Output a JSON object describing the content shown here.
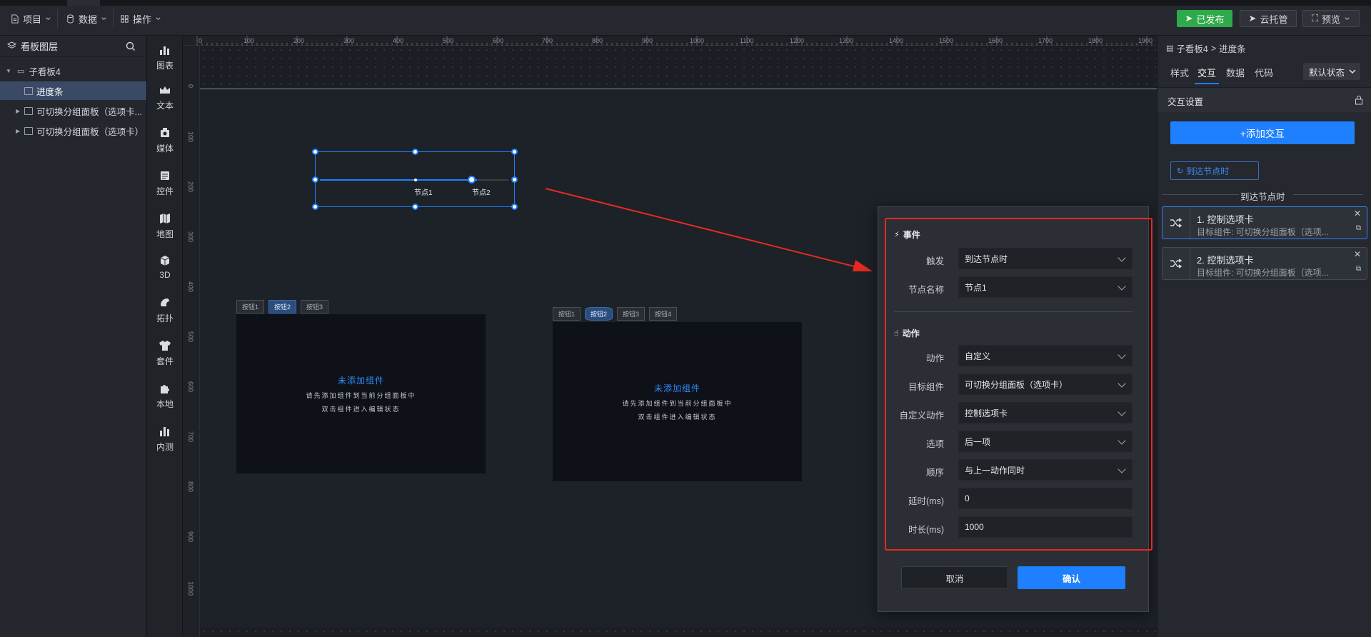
{
  "topbar": {
    "menus": [
      {
        "label": "项目",
        "icon": "file-icon"
      },
      {
        "label": "数据",
        "icon": "database-icon"
      },
      {
        "label": "操作",
        "icon": "grid-icon"
      }
    ],
    "publish_label": "已发布",
    "cloud_label": "云托管",
    "preview_label": "预览"
  },
  "layers": {
    "title": "看板图层",
    "items": [
      {
        "label": "子看板4"
      },
      {
        "label": "进度条"
      },
      {
        "label": "可切换分组面板（选项卡..."
      },
      {
        "label": "可切换分组面板（选项卡）"
      }
    ]
  },
  "iconbar": {
    "items": [
      {
        "label": "图表",
        "icon": "chart-icon"
      },
      {
        "label": "文本",
        "icon": "crown-icon"
      },
      {
        "label": "媒体",
        "icon": "media-icon"
      },
      {
        "label": "控件",
        "icon": "widget-icon"
      },
      {
        "label": "地图",
        "icon": "map-icon"
      },
      {
        "label": "3D",
        "icon": "cube-icon"
      },
      {
        "label": "拓扑",
        "icon": "topology-icon"
      },
      {
        "label": "套件",
        "icon": "shirt-icon"
      },
      {
        "label": "本地",
        "icon": "puzzle-icon"
      },
      {
        "label": "内测",
        "icon": "beta-chart-icon"
      }
    ]
  },
  "ruler": {
    "top": [
      "0",
      "100",
      "200",
      "300",
      "400",
      "500",
      "600",
      "700",
      "800",
      "900",
      "1000",
      "1100",
      "1200",
      "1300",
      "1400",
      "1500",
      "1600",
      "1700",
      "1800",
      "1900"
    ],
    "left": [
      "0",
      "100",
      "200",
      "300",
      "400",
      "500",
      "600",
      "700",
      "800",
      "900",
      "1000"
    ]
  },
  "canvas": {
    "progress": {
      "node1": "节点1",
      "node2": "节点2",
      "value": 0.75
    },
    "tabpanel1": {
      "tabs": [
        "按钮1",
        "按钮2",
        "按钮3"
      ],
      "active": 1,
      "empty_title": "未添加组件",
      "hint1": "请先添加组件到当前分组面板中",
      "hint2": "双击组件进入编辑状态"
    },
    "tabpanel2": {
      "tabs": [
        "按钮1",
        "按钮2",
        "按钮3",
        "按钮4"
      ],
      "active": 1,
      "empty_title": "未添加组件",
      "hint1": "请先添加组件到当前分组面板中",
      "hint2": "双击组件进入编辑状态"
    }
  },
  "dialog": {
    "event_title": "事件",
    "trigger_label": "触发",
    "trigger_value": "到达节点时",
    "node_label": "节点名称",
    "node_value": "节点1",
    "action_title": "动作",
    "action_label": "动作",
    "action_value": "自定义",
    "target_label": "目标组件",
    "target_value": "可切换分组面板（选项卡）",
    "custom_label": "自定义动作",
    "custom_value": "控制选项卡",
    "option_label": "选项",
    "option_value": "后一项",
    "order_label": "顺序",
    "order_value": "与上一动作同时",
    "delay_label": "延时(ms)",
    "delay_value": "0",
    "duration_label": "时长(ms)",
    "duration_value": "1000",
    "cancel_label": "取消",
    "confirm_label": "确认"
  },
  "rightpanel": {
    "breadcrumb_parent": "子看板4",
    "breadcrumb_sep": ">",
    "breadcrumb_current": "进度条",
    "tabs": [
      "样式",
      "交互",
      "数据",
      "代码"
    ],
    "active_tab": 1,
    "state_select": "默认状态",
    "section_title": "交互设置",
    "add_label": "+添加交互",
    "event_chip": "到达节点时",
    "group_title": "到达节点时",
    "cards": [
      {
        "title": "1. 控制选项卡",
        "sub": "目标组件: 可切换分组面板（选项..."
      },
      {
        "title": "2. 控制选项卡",
        "sub": "目标组件: 可切换分组面板（选项..."
      }
    ]
  },
  "colors": {
    "accent": "#1e80ff",
    "publish": "#2eaa4a",
    "highlight": "#e52a22"
  }
}
